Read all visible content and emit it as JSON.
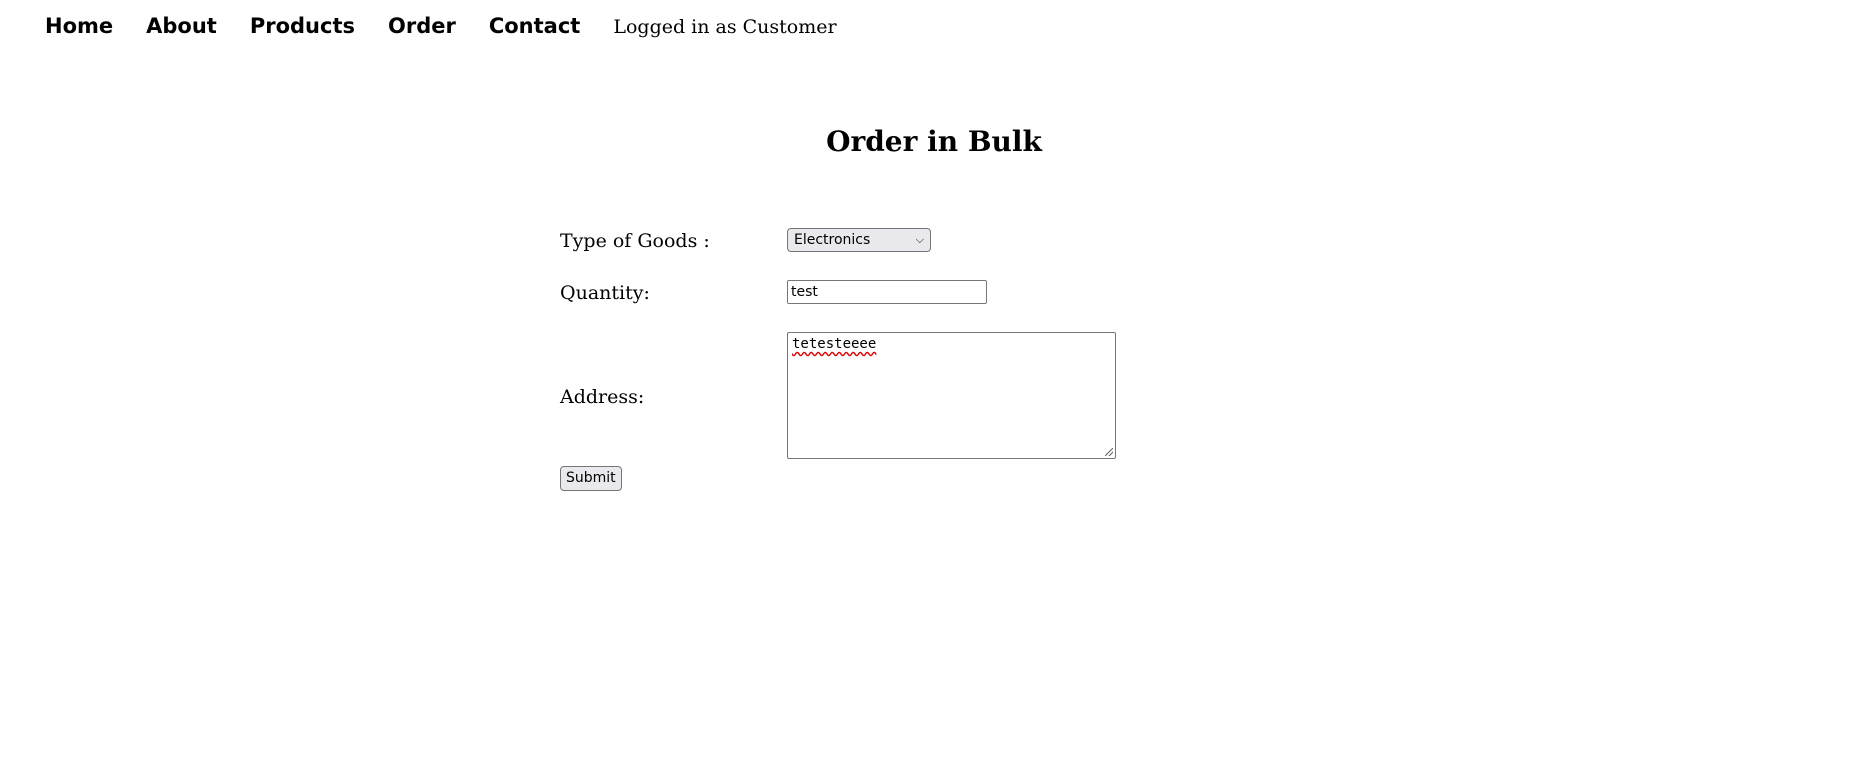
{
  "nav": {
    "items": [
      {
        "label": "Home"
      },
      {
        "label": "About"
      },
      {
        "label": "Products"
      },
      {
        "label": "Order"
      },
      {
        "label": "Contact"
      }
    ],
    "login_status": "Logged in as Customer"
  },
  "page": {
    "title": "Order in Bulk"
  },
  "form": {
    "goods_label": "Type of Goods :",
    "goods_selected": "Electronics",
    "quantity_label": "Quantity:",
    "quantity_value": "test",
    "address_label": "Address:",
    "address_value": "tetesteeee",
    "submit_label": "Submit"
  },
  "icons": {
    "select_arrow": "chevron-down-icon",
    "textarea_grip": "resize-grip-icon"
  }
}
